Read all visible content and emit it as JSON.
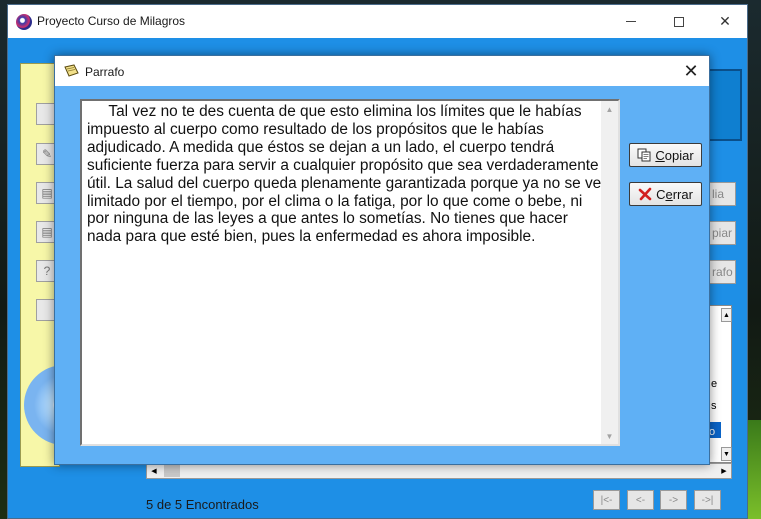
{
  "main_window": {
    "title": "Proyecto Curso de Milagros",
    "background_color": "#1e8fe6",
    "controls": {
      "minimize_icon": "minimize-icon",
      "maximize_icon": "maximize-icon",
      "close_icon": "close-icon",
      "close_glyph": "✕"
    },
    "side_buttons": [
      "",
      "",
      "",
      "",
      "?",
      ""
    ],
    "right_buttons": [
      "lia",
      "piar",
      "rafo"
    ],
    "list_items": [
      "e",
      "s",
      "o"
    ],
    "status": "5 de 5 Encontrados",
    "nav_buttons": [
      "|<-",
      "<-",
      "->",
      "->|"
    ]
  },
  "dialog": {
    "title": "Parrafo",
    "close_glyph": "✕",
    "text": "     Tal vez no te des cuenta de que esto elimina los límites que le habías impuesto al cuerpo como resultado de los propósitos que le habías adjudicado. A medida que éstos se dejan a un lado, el cuerpo tendrá suficiente fuerza para servir a cualquier propósito que sea verdaderamente útil. La salud del cuerpo queda plenamente garantizada porque ya no se ve limitado por el tiempo, por el clima o la fatiga, por lo que come o bebe, ni por ninguna de las leyes a que antes lo sometías. No tienes que hacer nada para que esté bien, pues la enfermedad es ahora imposible.",
    "buttons": {
      "copy": {
        "accel": "C",
        "rest": "opiar",
        "icon": "copy-icon"
      },
      "close": {
        "accel": "e",
        "pre": "C",
        "rest": "rrar",
        "icon": "red-x-icon"
      }
    },
    "background_color": "#5fb0f5"
  }
}
